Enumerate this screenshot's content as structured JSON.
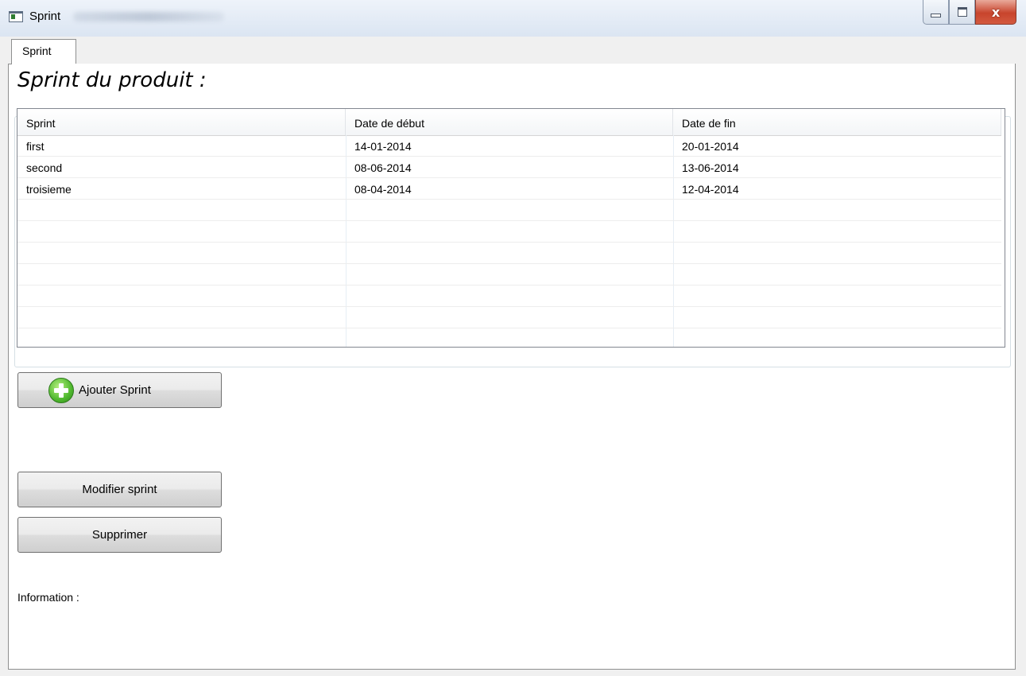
{
  "window": {
    "title": "Sprint",
    "close_glyph": "x"
  },
  "tab": {
    "label": "Sprint"
  },
  "heading": "Sprint du produit :",
  "table": {
    "columns": [
      "Sprint",
      "Date de début",
      "Date de fin"
    ],
    "rows": [
      [
        "first",
        "14-01-2014",
        "20-01-2014"
      ],
      [
        "second",
        "08-06-2014",
        "13-06-2014"
      ],
      [
        "troisieme",
        "08-04-2014",
        "12-04-2014"
      ]
    ]
  },
  "buttons": {
    "add_label": "Ajouter Sprint",
    "modify_label": "Modifier sprint",
    "delete_label": "Supprimer"
  },
  "info_label": "Information :",
  "icons": {
    "add": "plus-circle-icon",
    "app": "window-app-icon",
    "minimize": "minimize-icon",
    "maximize": "maximize-icon",
    "close": "close-icon"
  },
  "colors": {
    "titlebar": "#dbe5f2",
    "close_button": "#c8442c",
    "add_icon": "#4fb82e"
  }
}
